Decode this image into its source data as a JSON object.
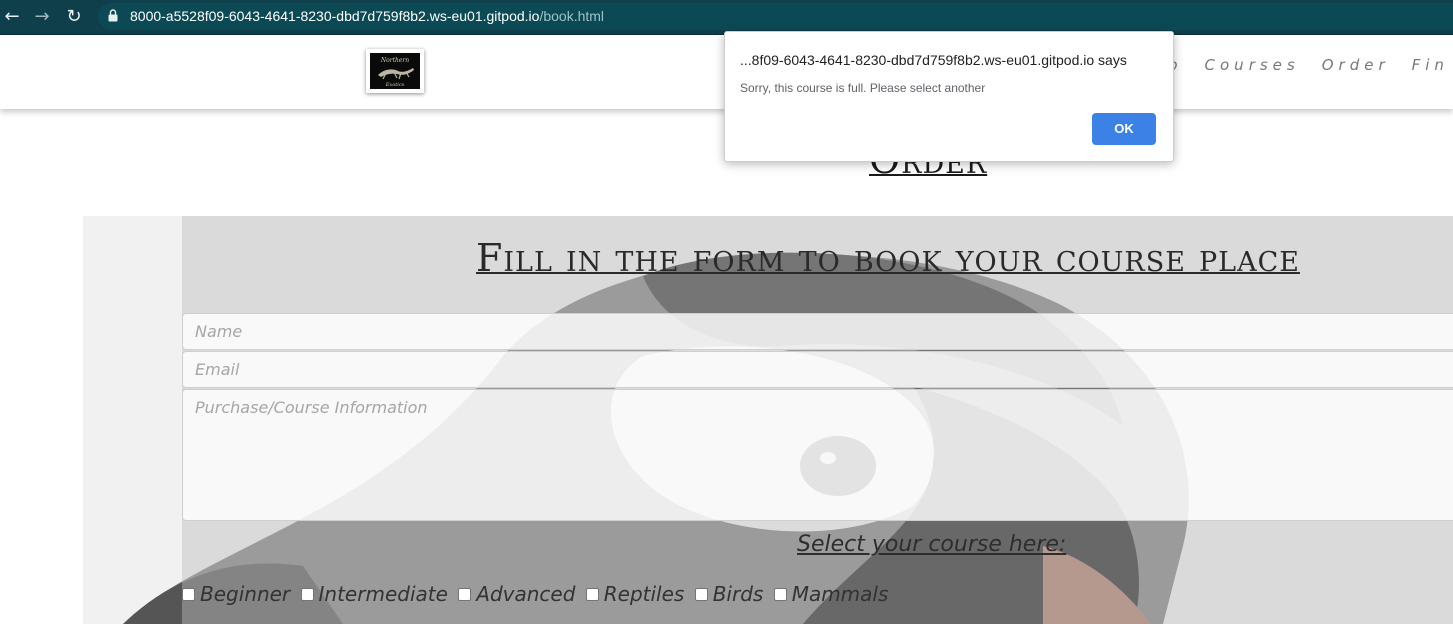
{
  "browser": {
    "url_host": "8000-a5528f09-6043-4641-8230-dbd7d759f8b2.ws-eu01.gitpod.io",
    "url_path": "/book.html",
    "back_icon": "arrow-left-icon",
    "forward_icon": "arrow-right-icon",
    "reload_icon": "reload-icon",
    "lock_icon": "lock-icon"
  },
  "header": {
    "logo_alt": "Northern Exotics logo",
    "nav": [
      "p",
      "Courses",
      "Order",
      "Fin"
    ]
  },
  "page": {
    "title": "Order"
  },
  "form": {
    "heading": "Fill in the form to book your course place",
    "name_placeholder": "Name",
    "email_placeholder": "Email",
    "info_placeholder": "Purchase/Course Information",
    "select_label": "Select your course here:",
    "courses": [
      "Beginner",
      "Intermediate",
      "Advanced",
      "Reptiles",
      "Birds",
      "Mammals"
    ]
  },
  "dialog": {
    "title": "...8f09-6043-4641-8230-dbd7d759f8b2.ws-eu01.gitpod.io says",
    "message": "Sorry, this course is full. Please select another",
    "ok_label": "OK"
  },
  "colors": {
    "chrome_bg": "#0f3f4a",
    "ok_button": "#3c82e6",
    "nav_text": "#777777"
  }
}
